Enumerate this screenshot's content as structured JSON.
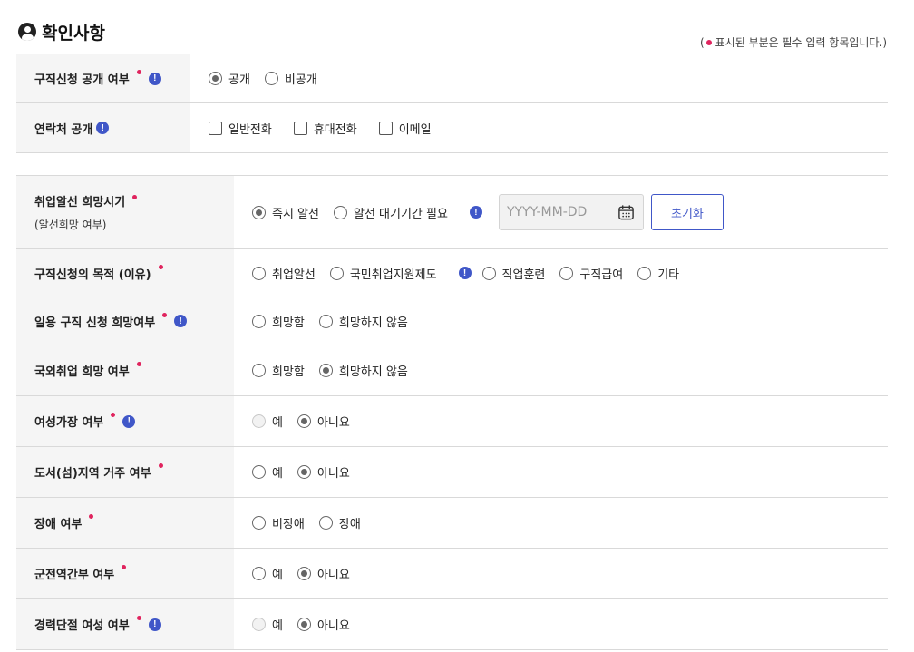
{
  "header": {
    "title": "확인사항",
    "required_note_open": "(",
    "required_note_text": "표시된 부분은 필수 입력 항목입니다.)"
  },
  "colors": {
    "required": "#e0245e",
    "info": "#4057c8",
    "accent": "#4057c8"
  },
  "rows": {
    "public": {
      "label": "구직신청 공개 여부",
      "options": [
        "공개",
        "비공개"
      ],
      "selected": "공개"
    },
    "contact": {
      "label": "연락처 공개",
      "options": [
        "일반전화",
        "휴대전화",
        "이메일"
      ]
    },
    "timing": {
      "label": "취업알선 희망시기",
      "sub": "(알선희망 여부)",
      "options": [
        "즉시 알선",
        "알선 대기기간 필요"
      ],
      "selected": "즉시 알선",
      "date_placeholder": "YYYY-MM-DD",
      "reset_label": "초기화"
    },
    "purpose": {
      "label": "구직신청의 목적 (이유)",
      "options": [
        "취업알선",
        "국민취업지원제도",
        "직업훈련",
        "구직급여",
        "기타"
      ]
    },
    "daily": {
      "label": "일용 구직 신청 희망여부",
      "options": [
        "희망함",
        "희망하지 않음"
      ]
    },
    "overseas": {
      "label": "국외취업 희망 여부",
      "options": [
        "희망함",
        "희망하지 않음"
      ],
      "selected": "희망하지 않음"
    },
    "female_head": {
      "label": "여성가장 여부",
      "options": [
        "예",
        "아니요"
      ],
      "selected": "아니요"
    },
    "island": {
      "label": "도서(섬)지역 거주 여부",
      "options": [
        "예",
        "아니요"
      ],
      "selected": "아니요"
    },
    "disability": {
      "label": "장애 여부",
      "options": [
        "비장애",
        "장애"
      ]
    },
    "military": {
      "label": "군전역간부 여부",
      "options": [
        "예",
        "아니요"
      ],
      "selected": "아니요"
    },
    "career_break": {
      "label": "경력단절 여성 여부",
      "options": [
        "예",
        "아니요"
      ],
      "selected": "아니요"
    }
  }
}
